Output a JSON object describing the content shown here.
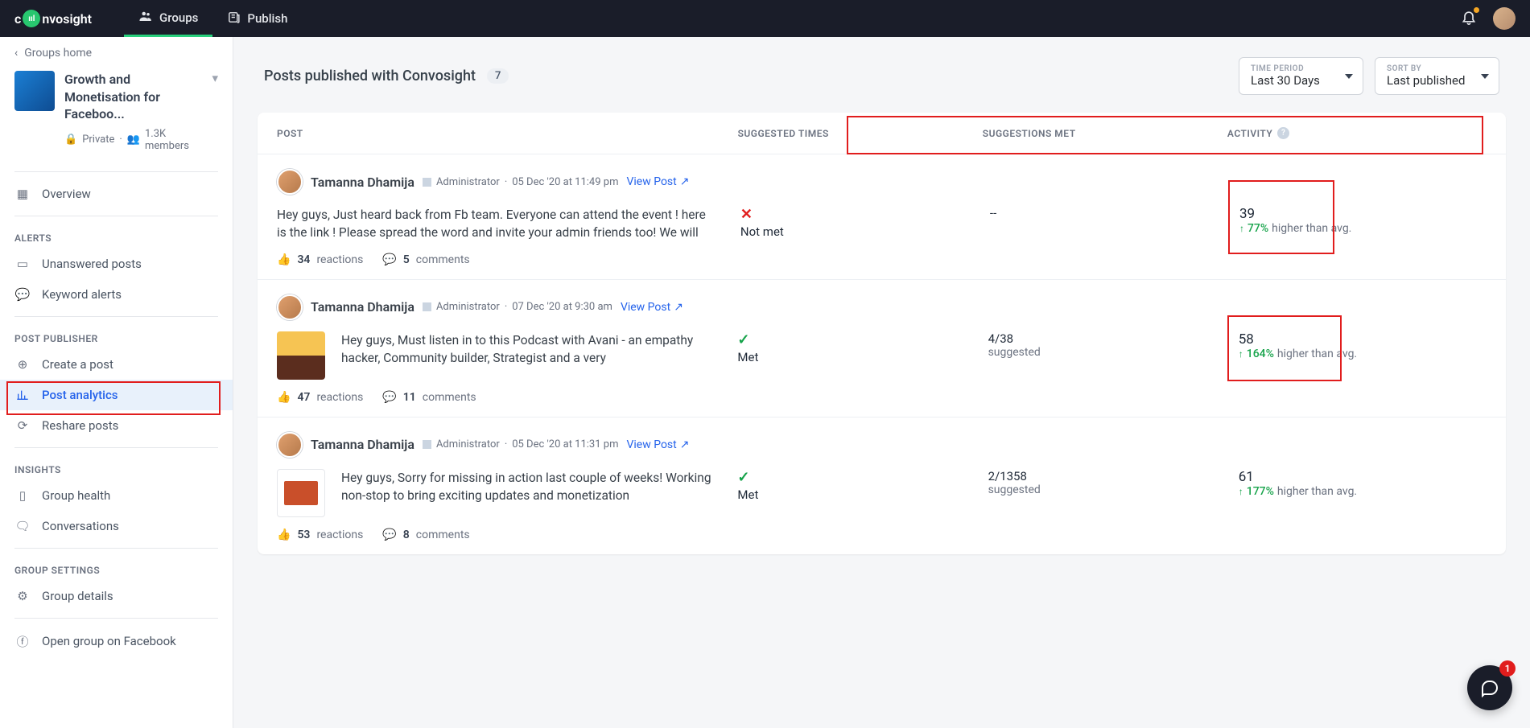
{
  "nav": {
    "logo_a": "c",
    "logo_b": "nvosight",
    "groups": "Groups",
    "publish": "Publish"
  },
  "sidebar": {
    "back": "Groups home",
    "group_title": "Growth and Monetisation for Faceboo...",
    "privacy": "Private",
    "members": "1.3K members",
    "overview": "Overview",
    "alerts_label": "ALERTS",
    "unanswered": "Unanswered posts",
    "keyword": "Keyword alerts",
    "pp_label": "POST PUBLISHER",
    "create": "Create a post",
    "analytics": "Post analytics",
    "reshare": "Reshare posts",
    "insights_label": "INSIGHTS",
    "health": "Group health",
    "conv": "Conversations",
    "gs_label": "GROUP SETTINGS",
    "details": "Group details",
    "openfb": "Open group on Facebook"
  },
  "main": {
    "title": "Posts published with Convosight",
    "count": "7",
    "tp_label": "TIME PERIOD",
    "tp_value": "Last 30 Days",
    "sort_label": "SORT BY",
    "sort_value": "Last published",
    "th_post": "POST",
    "th_a": "SUGGESTED TIMES",
    "th_b": "SUGGESTIONS MET",
    "th_c": "ACTIVITY"
  },
  "posts": [
    {
      "author": "Tamanna Dhamija",
      "role": "Administrator",
      "date": "05 Dec '20 at 11:49 pm",
      "view": "View Post",
      "text": "Hey guys, Just heard back from Fb team. Everyone can attend the event ! here is the link ! Please spread the word and invite your admin friends too! We will",
      "met_icon": "✕",
      "met_label": "Not met",
      "sug": "--",
      "sug_lbl": "",
      "act": "39",
      "pct": "77%",
      "tail": "higher than avg.",
      "reactions": "34",
      "comments": "5",
      "has_thumb": false
    },
    {
      "author": "Tamanna Dhamija",
      "role": "Administrator",
      "date": "07 Dec '20 at 9:30 am",
      "view": "View Post",
      "text": "Hey guys, Must listen in to this Podcast with Avani - an empathy hacker, Community builder, Strategist and a very",
      "met_icon": "✓",
      "met_label": "Met",
      "sug": "4/38",
      "sug_lbl": "suggested",
      "act": "58",
      "pct": "164%",
      "tail": "higher than avg.",
      "reactions": "47",
      "comments": "11",
      "has_thumb": true
    },
    {
      "author": "Tamanna Dhamija",
      "role": "Administrator",
      "date": "05 Dec '20 at 11:31 pm",
      "view": "View Post",
      "text": "Hey guys, Sorry for missing in action last couple of weeks! Working non-stop to bring exciting updates and monetization",
      "met_icon": "✓",
      "met_label": "Met",
      "sug": "2/1358",
      "sug_lbl": "suggested",
      "act": "61",
      "pct": "177%",
      "tail": "higher than avg.",
      "reactions": "53",
      "comments": "8",
      "has_thumb": true
    }
  ],
  "foot": {
    "reactions": "reactions",
    "comments": "comments"
  },
  "chat_badge": "1"
}
